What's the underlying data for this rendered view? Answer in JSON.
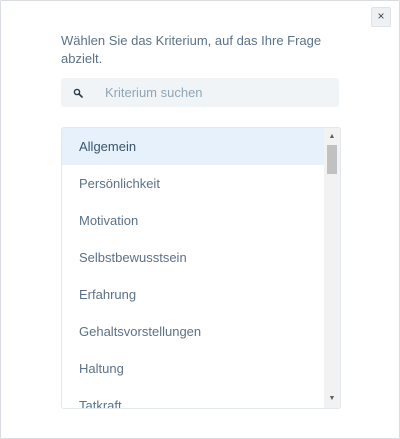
{
  "dialog": {
    "close_label": "×",
    "prompt": "Wählen Sie das Kriterium, auf das Ihre Frage abzielt."
  },
  "search": {
    "icon": "search-icon",
    "value": "",
    "placeholder": "Kriterium suchen"
  },
  "criteria": {
    "selected_index": 0,
    "items": [
      {
        "label": "Allgemein"
      },
      {
        "label": "Persönlichkeit"
      },
      {
        "label": "Motivation"
      },
      {
        "label": "Selbstbewusstsein"
      },
      {
        "label": "Erfahrung"
      },
      {
        "label": "Gehaltsvorstellungen"
      },
      {
        "label": "Haltung"
      },
      {
        "label": "Tatkraft"
      }
    ]
  },
  "colors": {
    "text": "#5b7286",
    "selected_bg": "#e6f1fb",
    "search_bg": "#f0f4f7"
  }
}
